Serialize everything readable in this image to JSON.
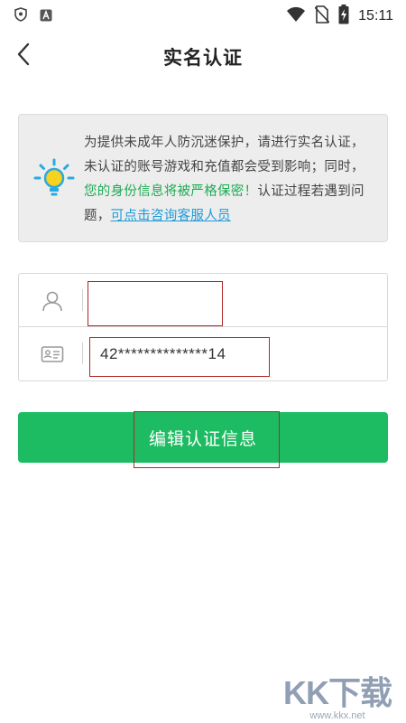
{
  "status_bar": {
    "time": "15:11",
    "left_icons": [
      "shield-icon",
      "a-letter-icon"
    ],
    "right_icons": [
      "wifi-icon",
      "no-sim-icon",
      "battery-charging-icon"
    ]
  },
  "header": {
    "title": "实名认证",
    "back_icon": "chevron-left-icon"
  },
  "notice": {
    "icon": "lightbulb-icon",
    "text_part1": "为提供未成年人防沉迷保护，请进行实名认证，未认证的账号游戏和充值都会受到影响；同时，",
    "text_highlight": "您的身份信息将被严格保密！",
    "text_part2": "认证过程若遇到问题，",
    "link_text": "可点击咨询客服人员",
    "colors": {
      "highlight": "#1dac52",
      "link": "#1e9bd7"
    }
  },
  "form": {
    "name_field": {
      "icon": "user-icon",
      "value": "",
      "placeholder": ""
    },
    "id_field": {
      "icon": "id-card-icon",
      "value": "42**************14"
    }
  },
  "edit_button": {
    "label": "编辑认证信息",
    "color": "#1dbc62"
  },
  "watermark": {
    "logo": "KK下载",
    "url": "www.kkx.net"
  }
}
